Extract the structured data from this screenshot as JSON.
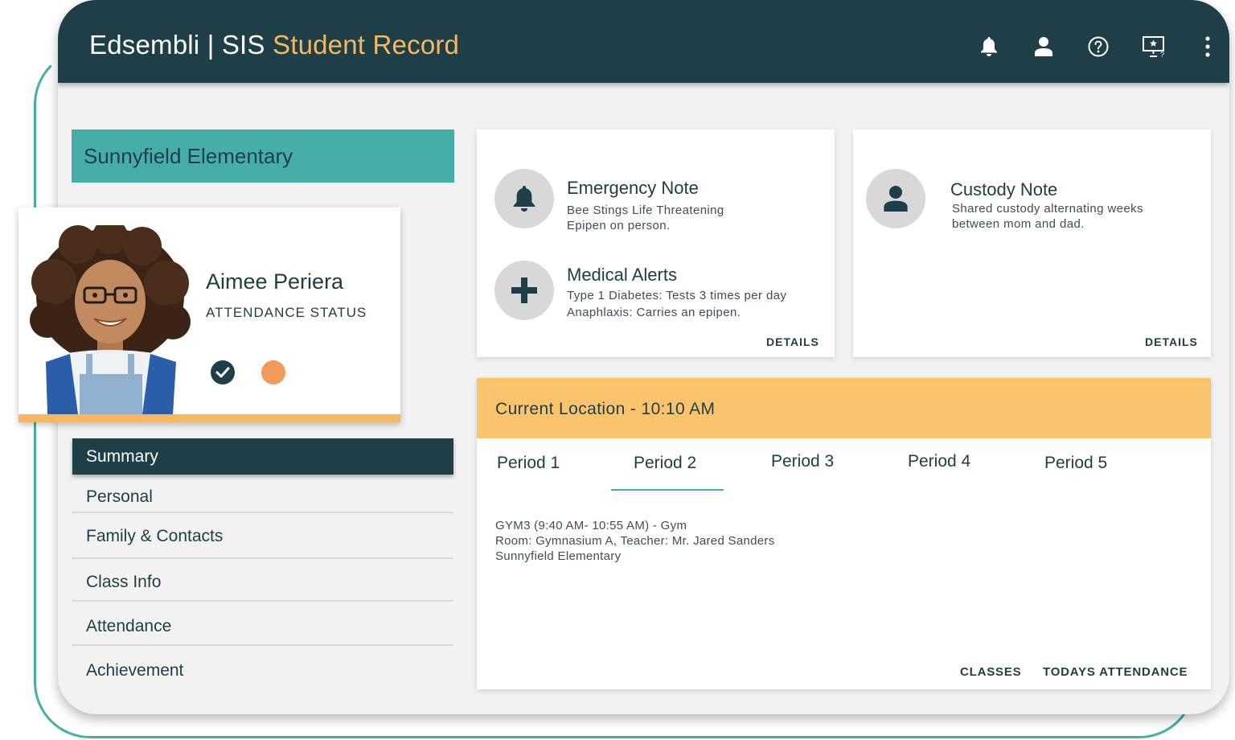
{
  "app": {
    "brand": "Edsembli | SIS",
    "section": "Student Record"
  },
  "header_icons": [
    "bell-icon",
    "user-icon",
    "help-icon",
    "presentation-icon",
    "more-vertical-icon"
  ],
  "school": {
    "name": "Sunnyfield Elementary"
  },
  "student": {
    "name": "Aimee Periera",
    "attendance_label": "ATTENDANCE STATUS",
    "status_colors": {
      "present": "#1e3e48",
      "alert": "#f29a5a"
    }
  },
  "nav": {
    "items": [
      {
        "label": "Summary"
      },
      {
        "label": "Personal"
      },
      {
        "label": "Family & Contacts"
      },
      {
        "label": "Class Info"
      },
      {
        "label": "Attendance"
      },
      {
        "label": "Achievement"
      }
    ]
  },
  "notes": {
    "emergency": {
      "title": "Emergency Note",
      "line1": "Bee Stings Life Threatening",
      "line2": "Epipen on person."
    },
    "medical": {
      "title": "Medical Alerts",
      "line1": "Type 1 Diabetes: Tests 3 times per day",
      "line2": "Anaphlaxis: Carries an epipen."
    },
    "details_label": "DETAILS",
    "custody": {
      "title": "Custody Note",
      "line1": "Shared custody alternating weeks",
      "line2": "between mom and dad.",
      "details_label": "DETAILS"
    }
  },
  "location": {
    "title": "Current Location - 10:10 AM",
    "periods": [
      "Period 1",
      "Period 2",
      "Period 3",
      "Period 4",
      "Period 5"
    ],
    "selected_period": "Period 2",
    "class": {
      "line1": "GYM3 (9:40 AM- 10:55 AM) - Gym",
      "line2": "Room: Gymnasium A, Teacher: Mr. Jared Sanders",
      "line3": "Sunnyfield Elementary"
    },
    "links": {
      "classes": "CLASSES",
      "todays_attendance": "TODAYS ATTENDANCE"
    }
  },
  "colors": {
    "header": "#1e3e48",
    "accent_orange": "#f5b861",
    "teal": "#46aea9",
    "location_bar": "#fbc46c"
  }
}
